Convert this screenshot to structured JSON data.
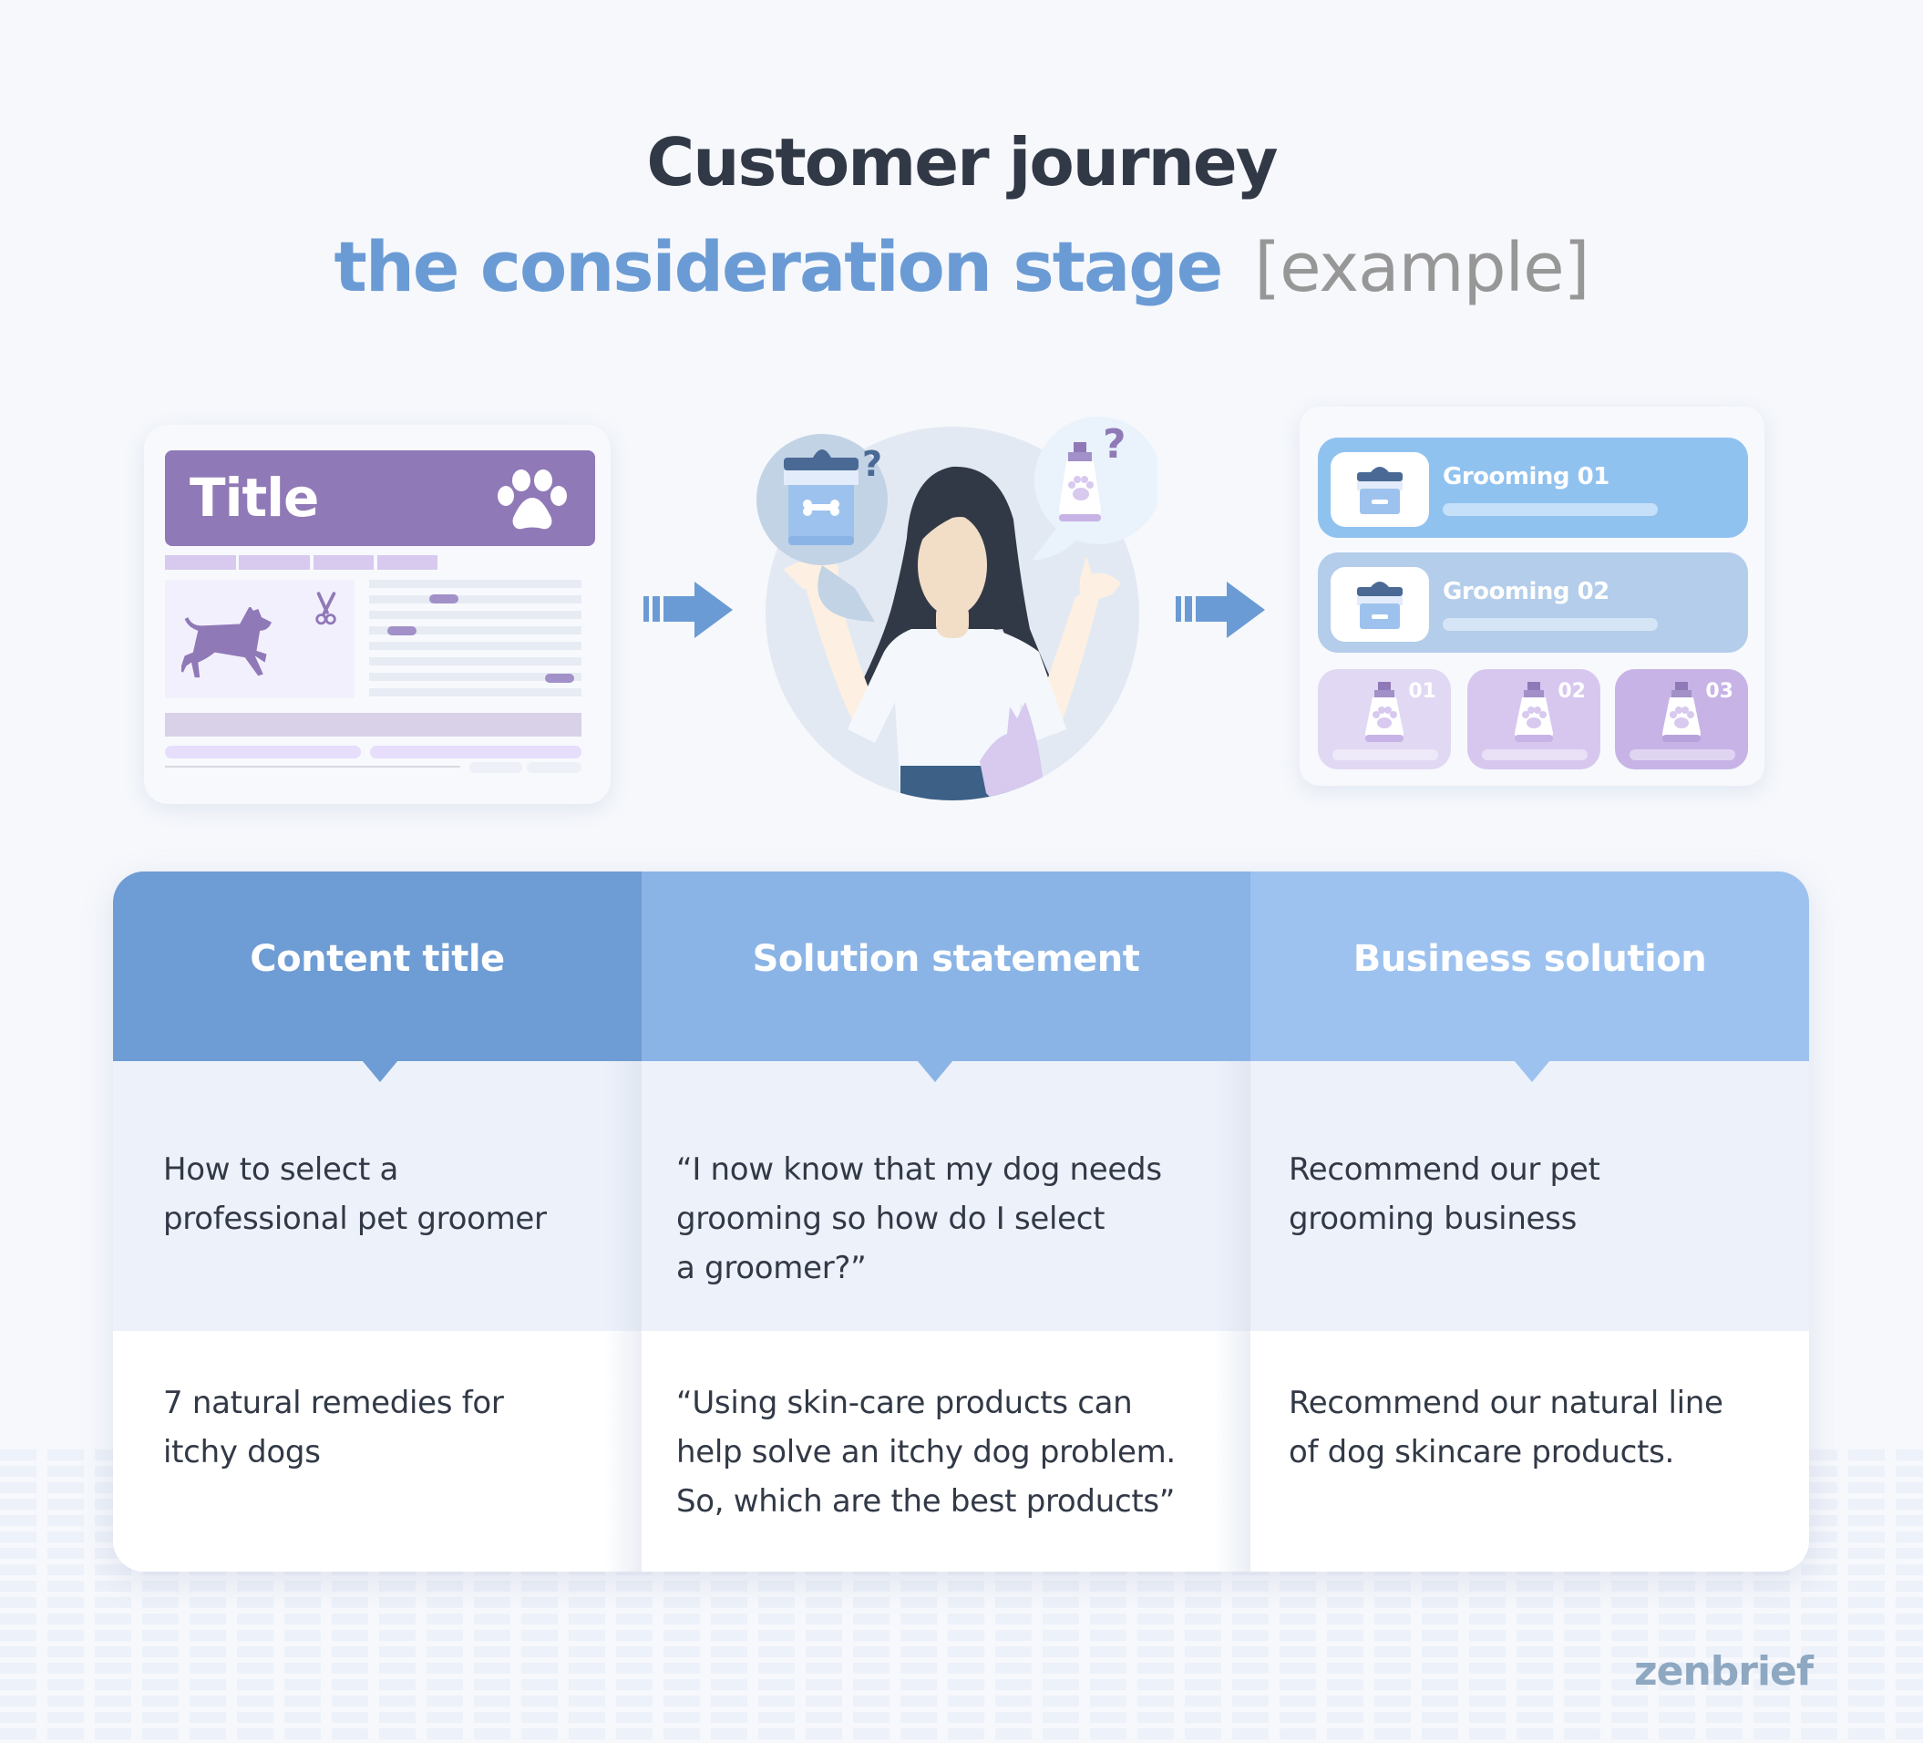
{
  "heading": {
    "line1": "Customer journey",
    "line2_stage": "the consideration stage",
    "line2_example": "[example]"
  },
  "colors": {
    "title_dark": "#323946",
    "accent_blue": "#6b9bd4",
    "purple": "#9079b7",
    "header_col1": "#6e9cd4",
    "header_col2": "#8bb4e6",
    "header_col3": "#9dc2ef",
    "brand": "#8ea8c2"
  },
  "illustration": {
    "content_card": {
      "title": "Title",
      "icons": [
        "paw-icon",
        "dog-icon",
        "scissors-icon"
      ]
    },
    "persona": {
      "thought_bubbles": [
        {
          "icon": "pet-shop-icon",
          "mark": "?"
        },
        {
          "icon": "shampoo-bottle-icon",
          "mark": "?"
        }
      ]
    },
    "business_panel": {
      "services": [
        {
          "label": "Grooming 01"
        },
        {
          "label": "Grooming 02"
        }
      ],
      "products": [
        {
          "number": "01"
        },
        {
          "number": "02"
        },
        {
          "number": "03"
        }
      ]
    }
  },
  "table": {
    "columns": [
      {
        "header": "Content title"
      },
      {
        "header": "Solution statement"
      },
      {
        "header": "Business solution"
      }
    ],
    "rows": [
      {
        "cells": [
          "How to select a\nprofessional pet groomer",
          "“I now know that my dog needs\ngrooming so how do I select\na groomer?”",
          "Recommend our pet\ngrooming business"
        ]
      },
      {
        "cells": [
          "7 natural remedies for\nitchy dogs",
          "“Using skin-care products can\nhelp solve an itchy dog problem.\nSo, which are the best products”",
          "Recommend our natural line\nof dog skincare products."
        ]
      }
    ]
  },
  "brand": "zenbrief"
}
